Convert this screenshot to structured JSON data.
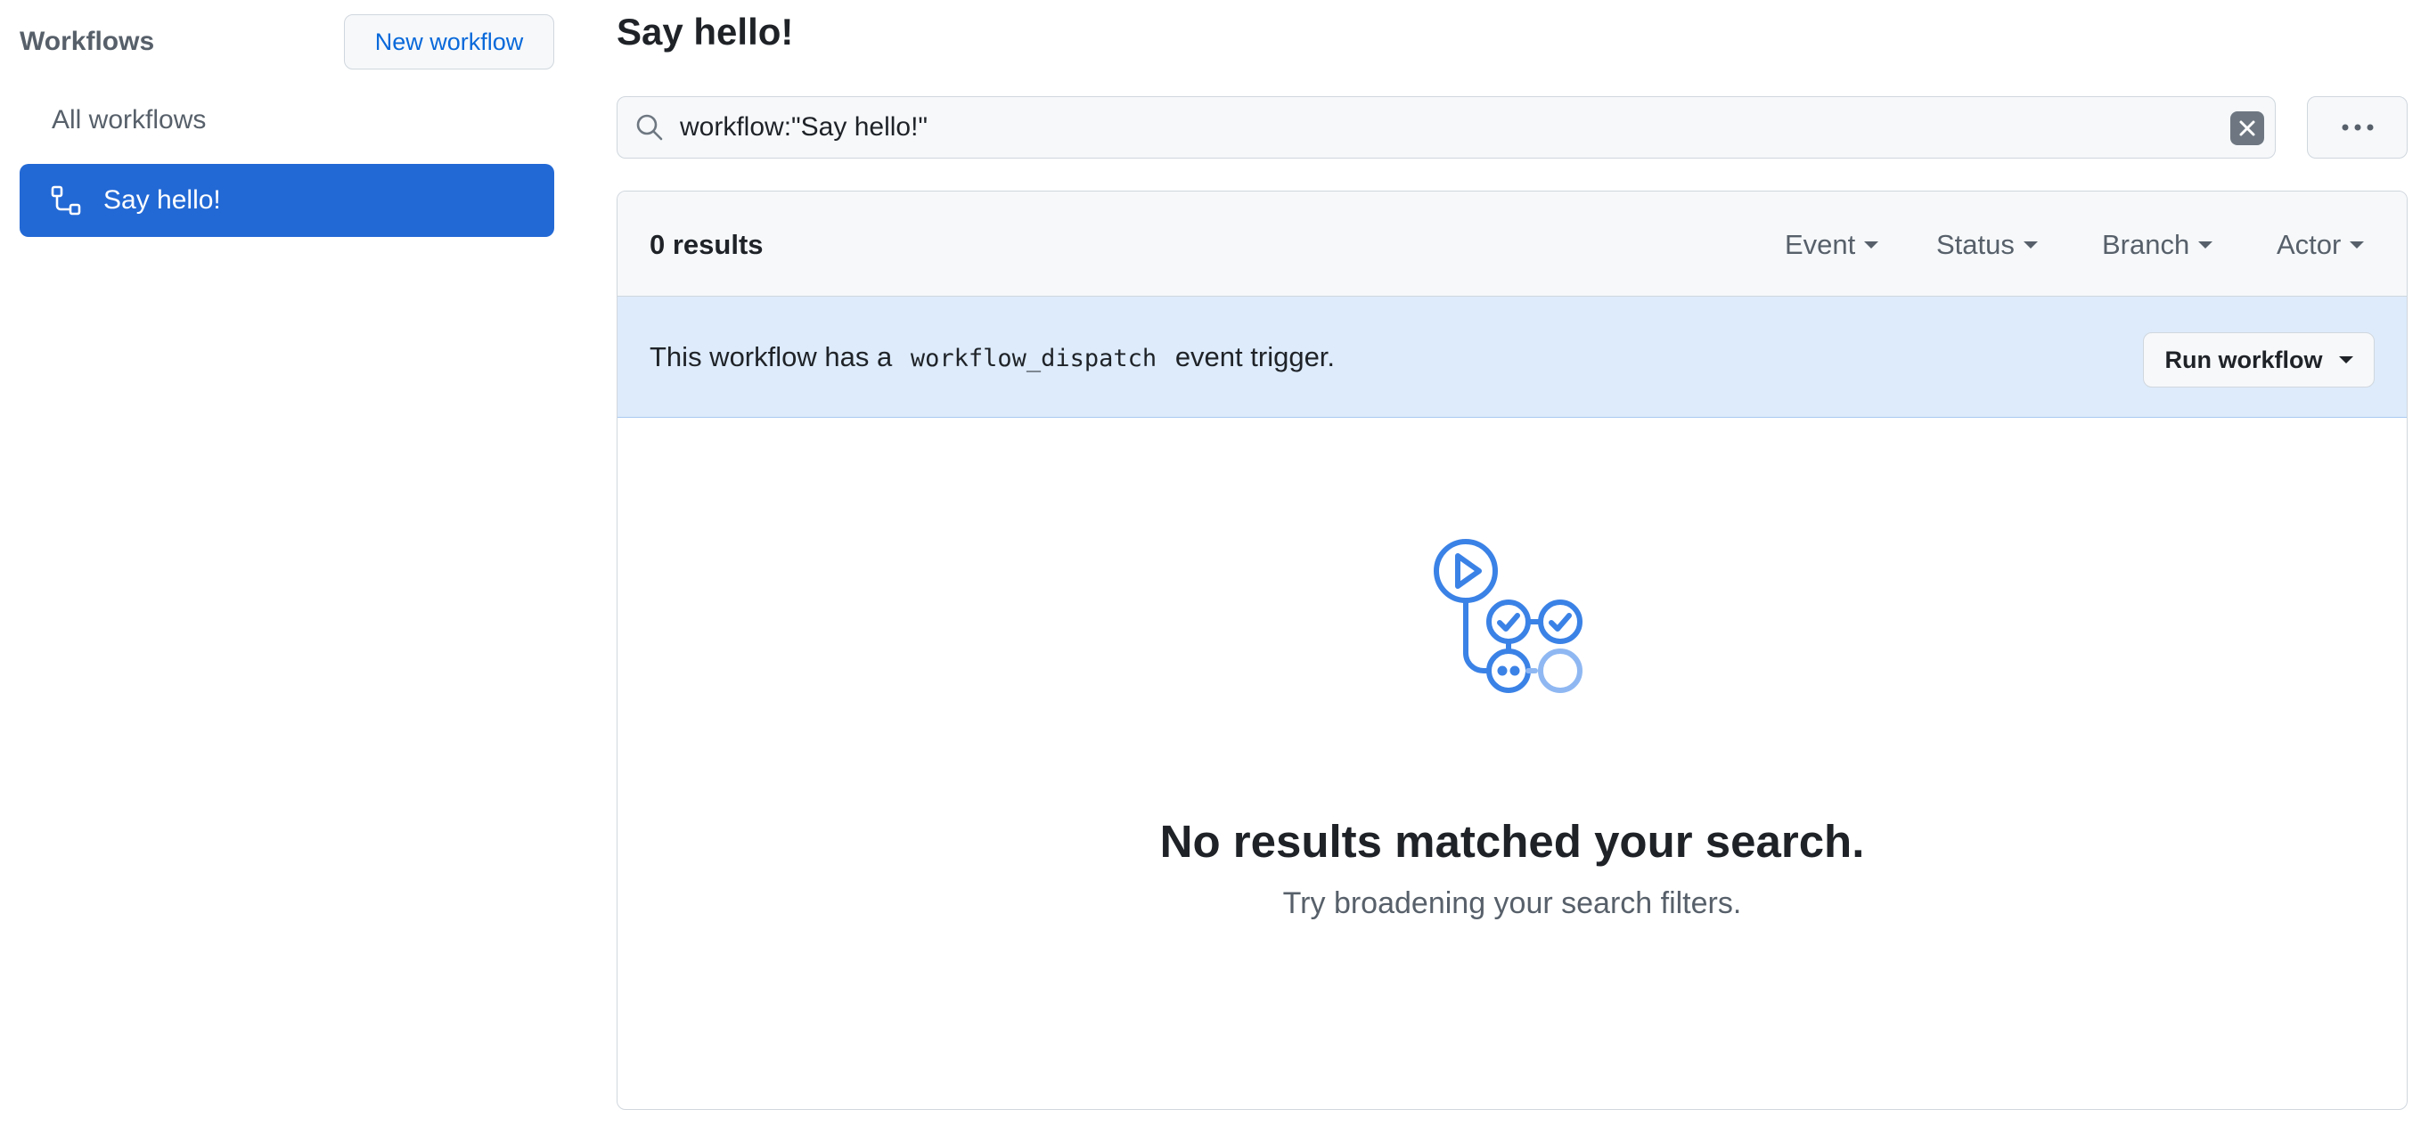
{
  "sidebar": {
    "title": "Workflows",
    "new_workflow_label": "New workflow",
    "all_workflows_label": "All workflows",
    "active_workflow_label": "Say hello!",
    "active_icon": "workflow-icon"
  },
  "main": {
    "title": "Say hello!",
    "search": {
      "value": "workflow:\"Say hello!\"",
      "icon": "search-icon",
      "clear_icon": "x-circle-icon"
    },
    "more_icon": "kebab-horizontal-icon",
    "results": {
      "count_label": "0 results",
      "filters": [
        "Event",
        "Status",
        "Branch",
        "Actor"
      ]
    },
    "dispatch": {
      "prefix": "This workflow has a",
      "code": "workflow_dispatch",
      "suffix": "event trigger.",
      "run_button_label": "Run workflow"
    },
    "empty_state": {
      "icon": "workflow-graph-icon",
      "title": "No results matched your search.",
      "subtitle": "Try broadening your search filters."
    }
  },
  "colors": {
    "accent": "#2369d5",
    "link": "#0969da",
    "banner_bg": "#ddebfb",
    "icon_blue": "#3b82e6"
  }
}
